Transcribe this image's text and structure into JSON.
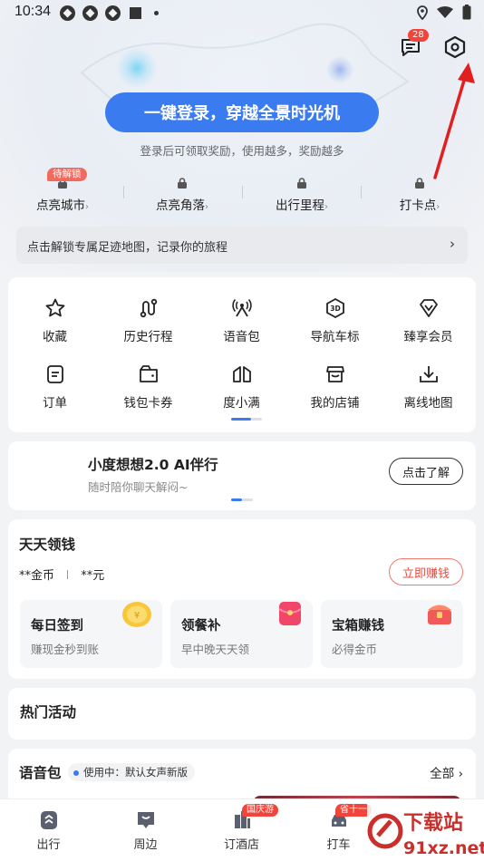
{
  "status_bar": {
    "time": "10:34"
  },
  "header": {
    "message_badge": "28",
    "login_button": "一键登录，穿越全景时光机",
    "login_subtitle": "登录后可领取奖励，使用越多，奖励越多",
    "unlock_badge": "待解锁",
    "locked_items": [
      {
        "label": "点亮城市"
      },
      {
        "label": "点亮角落"
      },
      {
        "label": "出行里程"
      },
      {
        "label": "打卡点"
      }
    ],
    "footprint_banner": "点击解锁专属足迹地图，记录你的旅程",
    "accent_color": "#3b7bf0"
  },
  "quick_grid": {
    "items": [
      {
        "label": "收藏",
        "icon": "star-icon"
      },
      {
        "label": "历史行程",
        "icon": "route-icon"
      },
      {
        "label": "语音包",
        "icon": "voice-pack-icon"
      },
      {
        "label": "导航车标",
        "icon": "car-3d-icon"
      },
      {
        "label": "臻享会员",
        "icon": "diamond-icon"
      },
      {
        "label": "订单",
        "icon": "order-icon"
      },
      {
        "label": "钱包卡券",
        "icon": "wallet-icon"
      },
      {
        "label": "度小满",
        "icon": "duxiaoman-icon"
      },
      {
        "label": "我的店铺",
        "icon": "shop-icon"
      },
      {
        "label": "离线地图",
        "icon": "download-icon"
      }
    ]
  },
  "ai_card": {
    "title": "小度想想2.0 AI伴行",
    "subtitle": "随时陪你聊天解闷~",
    "button": "点击了解"
  },
  "earn": {
    "title": "天天领钱",
    "coins": "**金币",
    "cash": "**元",
    "button": "立即赚钱",
    "tasks": [
      {
        "title": "每日签到",
        "sub": "赚现金秒到账"
      },
      {
        "title": "领餐补",
        "sub": "早中晚天天领"
      },
      {
        "title": "宝箱赚钱",
        "sub": "必得金币"
      }
    ]
  },
  "hot": {
    "title": "热门活动"
  },
  "voice_pack": {
    "title": "语音包",
    "status": "使用中：默认女声新版",
    "all": "全部"
  },
  "tabbar": {
    "tabs": [
      {
        "label": "出行"
      },
      {
        "label": "周边"
      },
      {
        "label": "订酒店",
        "badge": "国庆游"
      },
      {
        "label": "打车",
        "badge": "省十一"
      }
    ]
  },
  "watermark": {
    "main": "下载站",
    "sub": "91xz.net"
  }
}
